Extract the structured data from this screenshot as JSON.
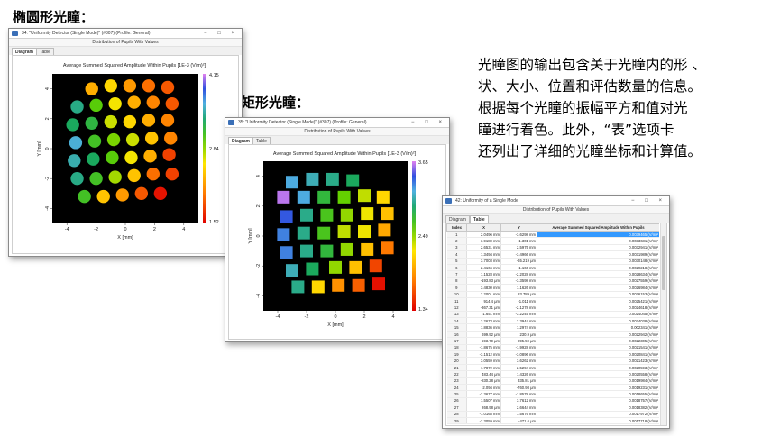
{
  "labels": {
    "ellipse": "椭圆形光瞳：",
    "rect": "矩形光瞳："
  },
  "description": [
    "光瞳图的输出包含关于光瞳内的形 、",
    "状、大小、位置和评估数量的信息。",
    "根据每个光瞳的振幅平方和值对光",
    "瞳进行着色。此外，“表”选项卡",
    "还列出了详细的光瞳坐标和计算值。"
  ],
  "icons": {
    "window": "window-app-icon",
    "controls": "window-controls-icon"
  },
  "colors": {
    "selection": "#3399ff",
    "plot_bg": "#000000",
    "window_border": "#8a8a8a"
  },
  "window1": {
    "title": "34: \"Uniformity Detector (Single Mode)\" (#307) (Profile: General)",
    "subtitle": "Distribution of Pupils With Values",
    "tabs": [
      "Diagram",
      "Table"
    ],
    "active_tab": "Diagram",
    "controls": "− □ ×"
  },
  "window2": {
    "title": "35: \"Uniformity Detector (Single Mode)\" (#307) (Profile: General)",
    "subtitle": "Distribution of Pupils With Values",
    "tabs": [
      "Diagram",
      "Table"
    ],
    "active_tab": "Diagram",
    "controls": "− □ ×"
  },
  "window3": {
    "title": "42: Uniformity of a Single Mode",
    "subtitle": "Distribution of Pupils With Values",
    "tabs": [
      "Diagram",
      "Table"
    ],
    "active_tab": "Table",
    "controls": "− □ ×",
    "headers": [
      "Index",
      "X",
      "Y",
      "Average Summed Squared Amplitude Within Pupils"
    ],
    "rows": [
      [
        "1",
        "2.0496 mm",
        "-3.6298 mm",
        "0.0039465 (V/m)²"
      ],
      [
        "2",
        "3.9180 mm",
        "-1.301 mm",
        "0.0033681 (V/m)²"
      ],
      [
        "3",
        "2.6531 mm",
        "2.5975 mm",
        "0.0032941 (V/m)²"
      ],
      [
        "4",
        "1.3494 mm",
        "-3.4966 mm",
        "0.0031989 (V/m)²"
      ],
      [
        "5",
        "3.7003 mm",
        "-65.219 μm",
        "0.0030148 (V/m)²"
      ],
      [
        "6",
        "2.4166 mm",
        "-1.166 mm",
        "0.0029218 (V/m)²"
      ],
      [
        "7",
        "1.1528 mm",
        "-2.2028 mm",
        "0.0028634 (V/m)²"
      ],
      [
        "8",
        "-193.83 μm",
        "-3.3598 mm",
        "0.0027559 (V/m)²"
      ],
      [
        "9",
        "3.4830 mm",
        "1.1626 mm",
        "0.0026984 (V/m)²"
      ],
      [
        "10",
        "2.2001 mm",
        "83.789 μm",
        "0.0026153 (V/m)²"
      ],
      [
        "11",
        "914.4 μm",
        "-1.011 mm",
        "0.0025421 (V/m)²"
      ],
      [
        "12",
        "-367.31 μm",
        "-2.1278 mm",
        "0.0024618 (V/m)²"
      ],
      [
        "13",
        "-1.651 mm",
        "-3.2245 mm",
        "0.0024045 (V/m)²"
      ],
      [
        "14",
        "3.2673 mm",
        "2.3944 mm",
        "0.0024038 (V/m)²"
      ],
      [
        "15",
        "1.8836 mm",
        "1.2974 mm",
        "0.002341 (V/m)²"
      ],
      [
        "16",
        "699.92 μm",
        "230.9 μm",
        "0.0022942 (V/m)²"
      ],
      [
        "17",
        "-593.79 μm",
        "-895.59 μm",
        "0.0022305 (V/m)²"
      ],
      [
        "18",
        "-1.8675 mm",
        "-1.9928 mm",
        "0.0021541 (V/m)²"
      ],
      [
        "19",
        "-3.1512 mm",
        "-3.0896 mm",
        "0.0020841 (V/m)²"
      ],
      [
        "20",
        "3.0559 mm",
        "3.6262 mm",
        "0.0021423 (V/m)²"
      ],
      [
        "21",
        "1.7872 mm",
        "2.5294 mm",
        "0.0020593 (V/m)²"
      ],
      [
        "22",
        "483.44 μm",
        "1.4326 mm",
        "0.0020558 (V/m)²"
      ],
      [
        "23",
        "-830.28 μm",
        "335.81 μm",
        "0.0019984 (V/m)²"
      ],
      [
        "24",
        "-2.094 mm",
        "-760.98 μm",
        "0.0019231 (V/m)²"
      ],
      [
        "25",
        "-2.3677 mm",
        "-1.8578 mm",
        "0.0018655 (V/m)²"
      ],
      [
        "26",
        "1.5507 mm",
        "3.7612 mm",
        "0.0018757 (V/m)²"
      ],
      [
        "27",
        "268.98 μm",
        "2.6644 mm",
        "0.0018382 (V/m)²"
      ],
      [
        "28",
        "-1.0168 mm",
        "1.5676 mm",
        "0.0017972 (V/m)²"
      ],
      [
        "29",
        "-2.3059 mm",
        "-471.6 μm",
        "0.0017718 (V/m)²"
      ]
    ]
  },
  "chart_data": [
    {
      "type": "scatter",
      "title": "Average Summed Squared Amplitude Within Pupils  [1E-3 (V/m)²]",
      "xlabel": "X [mm]",
      "ylabel": "Y [mm]",
      "xlim": [
        -5,
        5
      ],
      "ylim": [
        -5,
        5
      ],
      "x_ticks": [
        -4,
        -2,
        0,
        2,
        4
      ],
      "y_ticks": [
        -4,
        -2,
        0,
        2,
        4
      ],
      "colorbar": {
        "min": 1.52,
        "max": 4.15,
        "ticks": [
          "4.15",
          "2.84",
          "1.52"
        ]
      },
      "marker": "circle",
      "points": [
        {
          "x": -2.3,
          "y": 4.0,
          "v": 2.3
        },
        {
          "x": -1.0,
          "y": 4.2,
          "v": 2.5
        },
        {
          "x": 0.3,
          "y": 4.2,
          "v": 2.2
        },
        {
          "x": 1.6,
          "y": 4.2,
          "v": 2.0
        },
        {
          "x": 2.9,
          "y": 4.1,
          "v": 1.9
        },
        {
          "x": -3.3,
          "y": 2.8,
          "v": 3.4
        },
        {
          "x": -2.0,
          "y": 2.9,
          "v": 3.0
        },
        {
          "x": -0.7,
          "y": 3.0,
          "v": 2.6
        },
        {
          "x": 0.6,
          "y": 3.1,
          "v": 2.3
        },
        {
          "x": 1.9,
          "y": 3.1,
          "v": 2.1
        },
        {
          "x": 3.2,
          "y": 3.0,
          "v": 1.9
        },
        {
          "x": -3.6,
          "y": 1.6,
          "v": 3.3
        },
        {
          "x": -2.3,
          "y": 1.7,
          "v": 3.2
        },
        {
          "x": -1.0,
          "y": 1.8,
          "v": 2.7
        },
        {
          "x": 0.3,
          "y": 1.8,
          "v": 2.5
        },
        {
          "x": 1.6,
          "y": 1.9,
          "v": 2.3
        },
        {
          "x": 2.9,
          "y": 1.9,
          "v": 2.1
        },
        {
          "x": -3.4,
          "y": 0.4,
          "v": 3.6
        },
        {
          "x": -2.1,
          "y": 0.5,
          "v": 3.1
        },
        {
          "x": -0.8,
          "y": 0.6,
          "v": 2.9
        },
        {
          "x": 0.5,
          "y": 0.6,
          "v": 2.7
        },
        {
          "x": 1.8,
          "y": 0.7,
          "v": 2.4
        },
        {
          "x": 3.1,
          "y": 0.7,
          "v": 2.1
        },
        {
          "x": -3.5,
          "y": -0.8,
          "v": 3.5
        },
        {
          "x": -2.2,
          "y": -0.7,
          "v": 3.3
        },
        {
          "x": -0.9,
          "y": -0.6,
          "v": 3.0
        },
        {
          "x": 0.4,
          "y": -0.6,
          "v": 2.6
        },
        {
          "x": 1.7,
          "y": -0.5,
          "v": 2.3
        },
        {
          "x": 3.0,
          "y": -0.4,
          "v": 1.8
        },
        {
          "x": -3.3,
          "y": -2.0,
          "v": 3.4
        },
        {
          "x": -2.0,
          "y": -2.0,
          "v": 3.1
        },
        {
          "x": -0.7,
          "y": -1.9,
          "v": 2.8
        },
        {
          "x": 0.6,
          "y": -1.8,
          "v": 2.4
        },
        {
          "x": 1.9,
          "y": -1.7,
          "v": 2.0
        },
        {
          "x": 3.2,
          "y": -1.7,
          "v": 1.8
        },
        {
          "x": -2.8,
          "y": -3.2,
          "v": 3.1
        },
        {
          "x": -1.5,
          "y": -3.2,
          "v": 2.4
        },
        {
          "x": -0.2,
          "y": -3.1,
          "v": 2.2
        },
        {
          "x": 1.1,
          "y": -3.0,
          "v": 1.9
        },
        {
          "x": 2.4,
          "y": -3.0,
          "v": 1.6
        }
      ]
    },
    {
      "type": "scatter",
      "title": "Average Summed Squared Amplitude Within Pupils  [1E-3 (V/m)²]",
      "xlabel": "X [mm]",
      "ylabel": "Y [mm]",
      "xlim": [
        -5,
        5
      ],
      "ylim": [
        -5,
        5
      ],
      "x_ticks": [
        -4,
        -2,
        0,
        2,
        4
      ],
      "y_ticks": [
        -4,
        -2,
        0,
        2,
        4
      ],
      "colorbar": {
        "min": 1.34,
        "max": 3.65,
        "ticks": [
          "3.65",
          "2.49",
          "1.34"
        ]
      },
      "marker": "square",
      "points": [
        {
          "x": -3.0,
          "y": 3.6,
          "v": 3.2
        },
        {
          "x": -1.6,
          "y": 3.8,
          "v": 3.1
        },
        {
          "x": -0.2,
          "y": 3.8,
          "v": 3.0
        },
        {
          "x": 1.2,
          "y": 3.7,
          "v": 2.9
        },
        {
          "x": -3.6,
          "y": 2.6,
          "v": 3.6
        },
        {
          "x": -2.2,
          "y": 2.6,
          "v": 3.2
        },
        {
          "x": -0.8,
          "y": 2.6,
          "v": 2.8
        },
        {
          "x": 0.6,
          "y": 2.6,
          "v": 2.6
        },
        {
          "x": 2.0,
          "y": 2.7,
          "v": 2.4
        },
        {
          "x": 3.3,
          "y": 2.6,
          "v": 2.2
        },
        {
          "x": -3.4,
          "y": 1.3,
          "v": 3.4
        },
        {
          "x": -2.0,
          "y": 1.4,
          "v": 3.0
        },
        {
          "x": -0.6,
          "y": 1.4,
          "v": 2.7
        },
        {
          "x": 0.8,
          "y": 1.4,
          "v": 2.5
        },
        {
          "x": 2.2,
          "y": 1.5,
          "v": 2.3
        },
        {
          "x": 3.6,
          "y": 1.5,
          "v": 2.1
        },
        {
          "x": -3.6,
          "y": 0.1,
          "v": 3.3
        },
        {
          "x": -2.2,
          "y": 0.2,
          "v": 3.0
        },
        {
          "x": -0.8,
          "y": 0.2,
          "v": 2.7
        },
        {
          "x": 0.6,
          "y": 0.3,
          "v": 2.4
        },
        {
          "x": 2.0,
          "y": 0.3,
          "v": 2.3
        },
        {
          "x": 3.4,
          "y": 0.4,
          "v": 2.0
        },
        {
          "x": -3.4,
          "y": -1.1,
          "v": 3.3
        },
        {
          "x": -2.0,
          "y": -1.0,
          "v": 3.0
        },
        {
          "x": -0.6,
          "y": -1.0,
          "v": 2.8
        },
        {
          "x": 0.8,
          "y": -0.9,
          "v": 2.5
        },
        {
          "x": 2.2,
          "y": -0.9,
          "v": 2.1
        },
        {
          "x": 3.6,
          "y": -0.8,
          "v": 1.8
        },
        {
          "x": -3.0,
          "y": -2.3,
          "v": 3.1
        },
        {
          "x": -1.6,
          "y": -2.2,
          "v": 2.9
        },
        {
          "x": 0.0,
          "y": -2.1,
          "v": 2.5
        },
        {
          "x": 1.4,
          "y": -2.1,
          "v": 2.1
        },
        {
          "x": 2.8,
          "y": -2.0,
          "v": 1.6
        },
        {
          "x": -2.6,
          "y": -3.4,
          "v": 3.0
        },
        {
          "x": -1.2,
          "y": -3.4,
          "v": 2.2
        },
        {
          "x": 0.2,
          "y": -3.3,
          "v": 1.9
        },
        {
          "x": 1.6,
          "y": -3.3,
          "v": 1.7
        },
        {
          "x": 3.0,
          "y": -3.2,
          "v": 1.4
        }
      ]
    }
  ]
}
